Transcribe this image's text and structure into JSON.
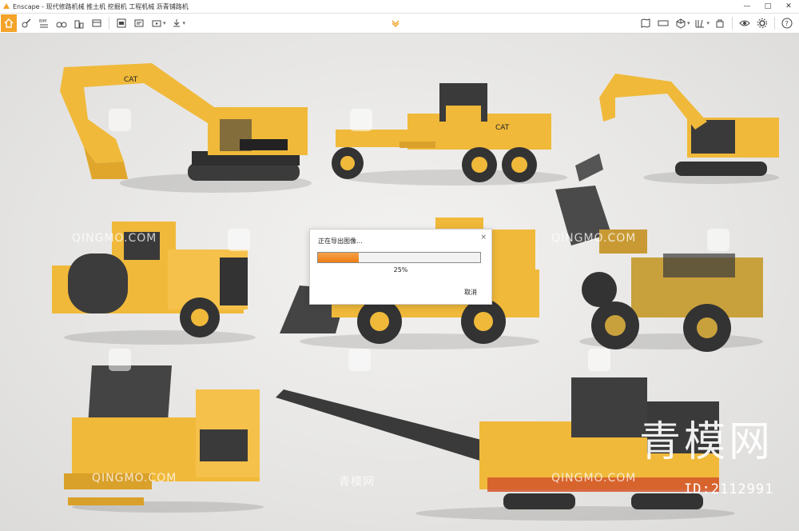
{
  "window": {
    "title": "Enscape - 现代修路机械 推土机 挖掘机 工程机械 沥青铺路机",
    "controls": [
      "—",
      "□",
      "✕"
    ]
  },
  "toolbar": {
    "left_icons": [
      "home-icon",
      "walk-icon",
      "bim-icon",
      "binoculars-icon",
      "buildings-icon",
      "scene-icon",
      "screenshot-icon",
      "batch-render-icon",
      "video-icon",
      "export-icon"
    ],
    "right_icons": [
      "map-icon",
      "panorama-icon",
      "cube-icon",
      "library-icon",
      "asset-icon",
      "eye-icon",
      "settings-icon",
      "help-icon"
    ],
    "center_icon": "collapse-chevron-icon"
  },
  "watermarks": {
    "qingmo": "QINGMO.COM",
    "brand_cn": "青模网",
    "brand_big": "青模网",
    "id": "ID:2112991"
  },
  "dialog": {
    "title": "正在导出图像...",
    "close": "×",
    "progress": 0.25,
    "percent_label": "25%",
    "cancel_label": "取消"
  },
  "colors": {
    "accent": "#f4a32a",
    "progress": "#ee7d14",
    "machine_yellow": "#f0b93a",
    "machine_dark": "#3a3a3a"
  }
}
